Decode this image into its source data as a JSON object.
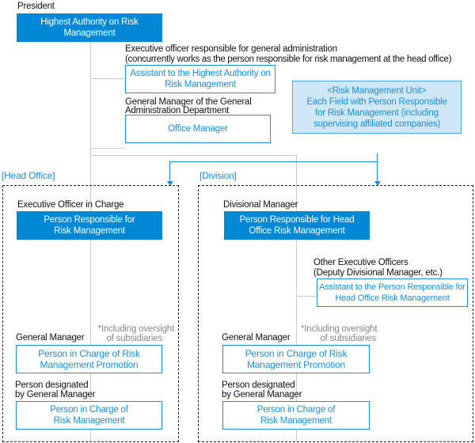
{
  "president_label": "President",
  "highest_authority": "Highest Authority on Risk Management",
  "exec_officer_label_1": "Executive officer responsible for general administration",
  "exec_officer_label_2": "(concurrently works as the person responsible for risk management at the head office)",
  "assistant_highest": "Assistant to the Highest Authority on Risk Management",
  "gm_admin_label_1": "General Manager of the General",
  "gm_admin_label_2": "Administration Department",
  "office_manager": "Office Manager",
  "risk_unit": {
    "title": "<Risk Management Unit>",
    "body": "Each Field with Person Responsible for Risk Management (including supervising affiliated companies)"
  },
  "head_office": {
    "section_label": "[Head Office]",
    "officer_label": "Executive Officer in Charge",
    "responsible": "Person Responsible for Risk Management",
    "note_1": "*Including oversight",
    "note_2": "of subsidiaries",
    "gm_label": "General Manager",
    "promotion": "Person in Charge of Risk Management Promotion",
    "designated_1": "Person designated",
    "designated_2": "by General Manager",
    "in_charge": "Person in Charge of Risk Management"
  },
  "division": {
    "section_label": "[Division]",
    "manager_label": "Divisional Manager",
    "responsible": "Person Responsible for Head Office Risk Management",
    "other_label_1": "Other Executive Officers",
    "other_label_2": "(Deputy Divisional Manager, etc.)",
    "assistant": "Assistant to the Person Responsible for Head Office Risk Management",
    "note_1": "*Including oversight",
    "note_2": "of subsidiaries",
    "gm_label": "General Manager",
    "promotion": "Person in Charge of Risk Management Promotion",
    "designated_1": "Person designated",
    "designated_2": "by General Manager",
    "in_charge": "Person in Charge of Risk Management"
  },
  "colors": {
    "primary": "#0088d6",
    "accent": "#1a8ee0",
    "unit_fill": "#cfe7f7",
    "connector": "#cccccc"
  }
}
